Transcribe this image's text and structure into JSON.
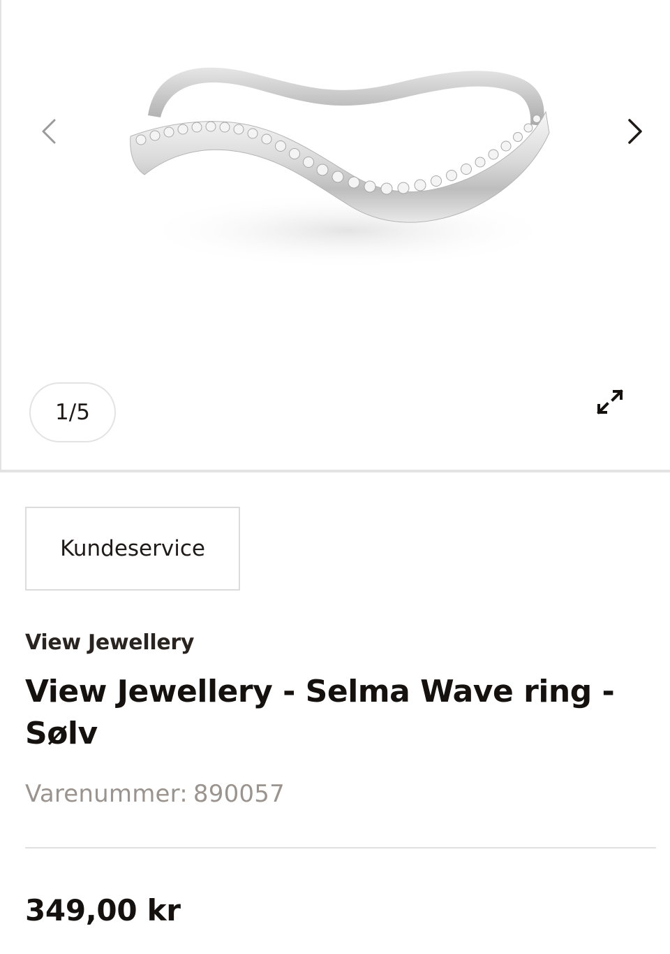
{
  "gallery": {
    "image_alt": "View Jewellery - Selma Wave ring - Sølv",
    "counter": "1/5",
    "prev_icon": "chevron-left-icon",
    "next_icon": "chevron-right-icon",
    "expand_icon": "expand-icon"
  },
  "customer_service": {
    "label": "Kundeservice"
  },
  "product": {
    "brand": "View Jewellery",
    "title": "View Jewellery - Selma Wave ring - Sølv",
    "sku_label": "Varenummer:",
    "sku_value": "890057",
    "price": "349,00 kr"
  },
  "colors": {
    "text_primary": "#15110f",
    "text_muted": "#9a938e",
    "border": "#e3e3e3"
  }
}
